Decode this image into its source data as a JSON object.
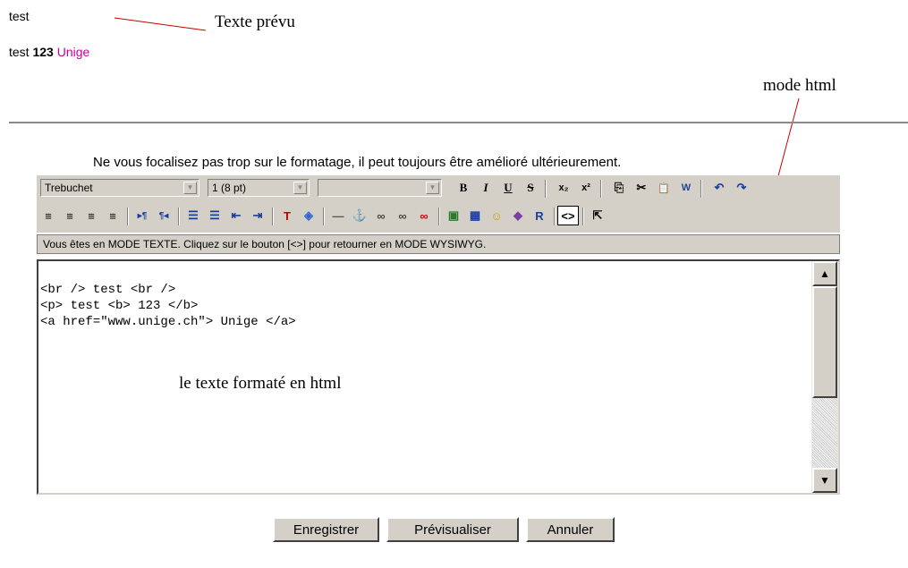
{
  "preview": {
    "line1": "test",
    "line2_text": "test",
    "line2_bold": "123",
    "line2_link": "Unige",
    "link_color": "#cc0099"
  },
  "annotations": {
    "texte_prevu": "Texte prévu",
    "mode_html": "mode html",
    "texte_formate": "le texte formaté en html"
  },
  "hint": "Ne vous focalisez pas trop sur le formatage, il peut toujours être amélioré ultérieurement.",
  "toolbar": {
    "font_select": "Trebuchet",
    "size_select": "1 (8 pt)",
    "style_select": "",
    "row1_buttons": [
      {
        "name": "bold-icon",
        "glyph": "B"
      },
      {
        "name": "italic-icon",
        "glyph": "I"
      },
      {
        "name": "underline-icon",
        "glyph": "U"
      },
      {
        "name": "strikethrough-icon",
        "glyph": "S"
      },
      {
        "name": "subscript-icon",
        "glyph": "x₂"
      },
      {
        "name": "superscript-icon",
        "glyph": "x²"
      },
      {
        "name": "copy-icon",
        "glyph": "⎘"
      },
      {
        "name": "cut-icon",
        "glyph": "✂"
      },
      {
        "name": "paste-icon",
        "glyph": "📋"
      },
      {
        "name": "paste-word-icon",
        "glyph": "W"
      },
      {
        "name": "undo-icon",
        "glyph": "↶"
      },
      {
        "name": "redo-icon",
        "glyph": "↷"
      }
    ],
    "row2_buttons": [
      {
        "name": "align-left-icon",
        "glyph": "≡"
      },
      {
        "name": "align-center-icon",
        "glyph": "≡"
      },
      {
        "name": "align-right-icon",
        "glyph": "≡"
      },
      {
        "name": "align-justify-icon",
        "glyph": "≡"
      },
      {
        "name": "ltr-icon",
        "glyph": "▸¶"
      },
      {
        "name": "rtl-icon",
        "glyph": "¶◂"
      },
      {
        "name": "ordered-list-icon",
        "glyph": "☰"
      },
      {
        "name": "unordered-list-icon",
        "glyph": "☰"
      },
      {
        "name": "outdent-icon",
        "glyph": "⇤"
      },
      {
        "name": "indent-icon",
        "glyph": "⇥"
      },
      {
        "name": "text-color-icon",
        "glyph": "T"
      },
      {
        "name": "bg-color-icon",
        "glyph": "◈"
      },
      {
        "name": "horizontal-rule-icon",
        "glyph": "—"
      },
      {
        "name": "anchor-icon",
        "glyph": "⚓"
      },
      {
        "name": "link-icon",
        "glyph": "∞"
      },
      {
        "name": "unlink-icon",
        "glyph": "∞"
      },
      {
        "name": "remove-link-icon",
        "glyph": "∞"
      },
      {
        "name": "image-icon",
        "glyph": "▣"
      },
      {
        "name": "table-icon",
        "glyph": "▦"
      },
      {
        "name": "smiley-icon",
        "glyph": "☺"
      },
      {
        "name": "special-char-icon",
        "glyph": "◆"
      },
      {
        "name": "paste-special-icon",
        "glyph": "R"
      },
      {
        "name": "html-mode-icon",
        "glyph": "<>"
      },
      {
        "name": "fullscreen-icon",
        "glyph": "⇱"
      }
    ]
  },
  "status": "Vous êtes en MODE TEXTE. Cliquez sur le bouton [<>] pour retourner en MODE WYSIWYG.",
  "editor": {
    "code": "<br /> test <br />\n<p> test <b> 123 </b>\n<a href=\"www.unige.ch\"> Unige </a>"
  },
  "buttons": {
    "save": "Enregistrer",
    "preview": "Prévisualiser",
    "cancel": "Annuler"
  }
}
